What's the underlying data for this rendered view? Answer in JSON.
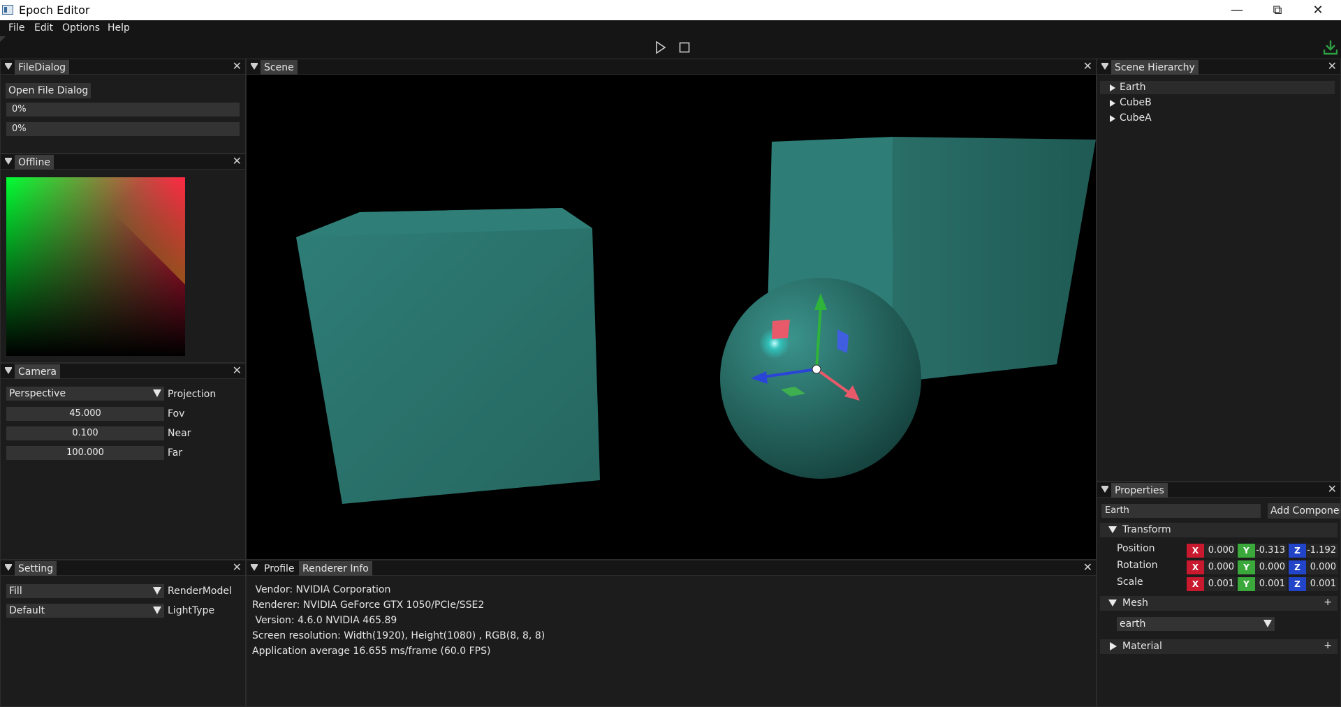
{
  "window": {
    "title": "Epoch Editor",
    "minimize": "—",
    "restore": "⧉",
    "close": "✕"
  },
  "menu": [
    "File",
    "Edit",
    "Options",
    "Help"
  ],
  "toolbar": {
    "play_icon": "play-icon",
    "stop_icon": "stop-icon",
    "download_icon": "download-icon",
    "download_color": "#2ea043"
  },
  "filedialog": {
    "title": "FileDialog",
    "button": "Open File Dialog",
    "progress": [
      "0%",
      "0%"
    ],
    "progress_values": [
      0,
      0
    ]
  },
  "offline": {
    "title": "Offline"
  },
  "camera": {
    "title": "Camera",
    "projection_value": "Perspective",
    "projection_label": "Projection",
    "fov_value": "45.000",
    "fov_label": "Fov",
    "near_value": "0.100",
    "near_label": "Near",
    "far_value": "100.000",
    "far_label": "Far"
  },
  "setting": {
    "title": "Setting",
    "render_value": "Fill",
    "render_label": "RenderModel",
    "light_value": "Default",
    "light_label": "LightType"
  },
  "scene": {
    "title": "Scene",
    "object_color": "#2f7e78"
  },
  "hierarchy": {
    "title": "Scene Hierarchy",
    "items": [
      "Earth",
      "CubeB",
      "CubeA"
    ],
    "selected": "Earth"
  },
  "properties": {
    "title": "Properties",
    "name": "Earth",
    "add_component": "Add Componer",
    "transform_label": "Transform",
    "rows": [
      {
        "label": "Position",
        "x": "0.000",
        "y": "-0.313",
        "z": "-1.192"
      },
      {
        "label": "Rotation",
        "x": "0.000",
        "y": "0.000",
        "z": "0.000"
      },
      {
        "label": "Scale",
        "x": "0.001",
        "y": "0.001",
        "z": "0.001"
      }
    ],
    "axis": {
      "x": "X",
      "y": "Y",
      "z": "Z"
    },
    "mesh_label": "Mesh",
    "mesh_value": "earth",
    "material_label": "Material",
    "plus": "+"
  },
  "bottom": {
    "tabs": [
      "Profile",
      "Renderer Info"
    ],
    "active_tab": "Renderer Info",
    "lines": [
      " Vendor: NVIDIA Corporation",
      "Renderer: NVIDIA GeForce GTX 1050/PCIe/SSE2",
      " Version: 4.6.0 NVIDIA 465.89",
      "Screen resolution: Width(1920), Height(1080) , RGB(8, 8, 8)",
      "Application average 16.655 ms/frame (60.0 FPS)"
    ]
  }
}
